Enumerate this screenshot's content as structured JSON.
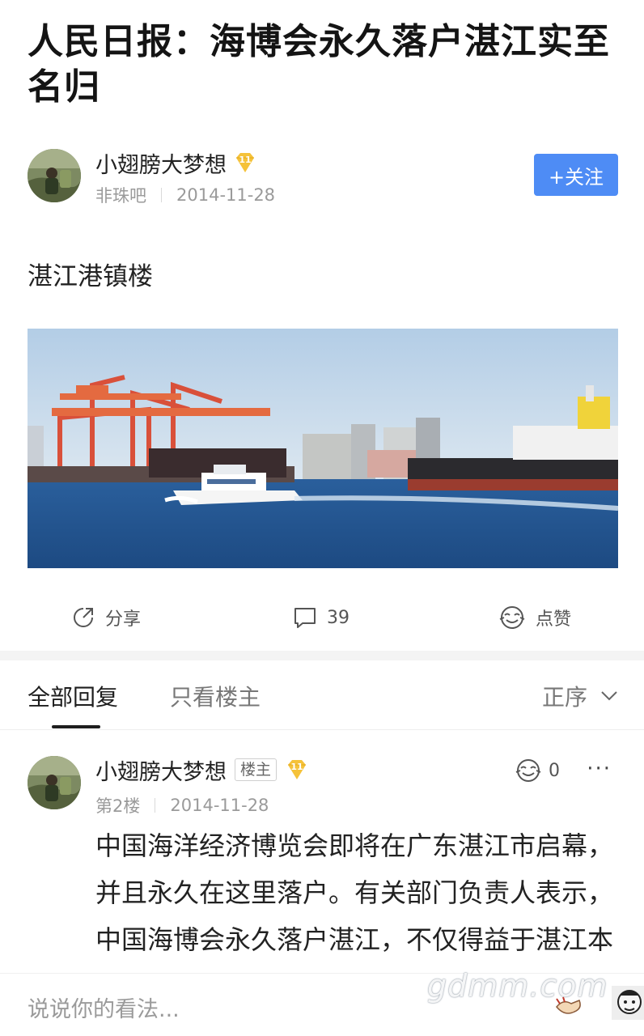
{
  "post": {
    "title": "人民日报：海博会永久落户湛江实至名归",
    "body": "湛江港镇楼"
  },
  "author": {
    "name": "小翅膀大梦想",
    "level": "11",
    "forum": "非珠吧",
    "date": "2014-11-28",
    "follow_label": "+关注"
  },
  "actions": {
    "share_label": "分享",
    "comment_count": "39",
    "like_label": "点赞"
  },
  "tabs": {
    "all_replies": "全部回复",
    "owner_only": "只看楼主",
    "sort_label": "正序"
  },
  "reply": {
    "name": "小翅膀大梦想",
    "owner_tag": "楼主",
    "level": "11",
    "floor": "第2楼",
    "date": "2014-11-28",
    "like_count": "0",
    "more": "···",
    "text": "中国海洋经济博览会即将在广东湛江市启幕，并且永久在这里落户。有关部门负责人表示，中国海博会永久落户湛江，不仅得益于湛江本身优越的海洋资源和区位优"
  },
  "input": {
    "placeholder": "说说你的看法..."
  },
  "watermark": "gdmm.com",
  "colors": {
    "accent": "#4e8cf5",
    "badge": "#f5c23a"
  }
}
